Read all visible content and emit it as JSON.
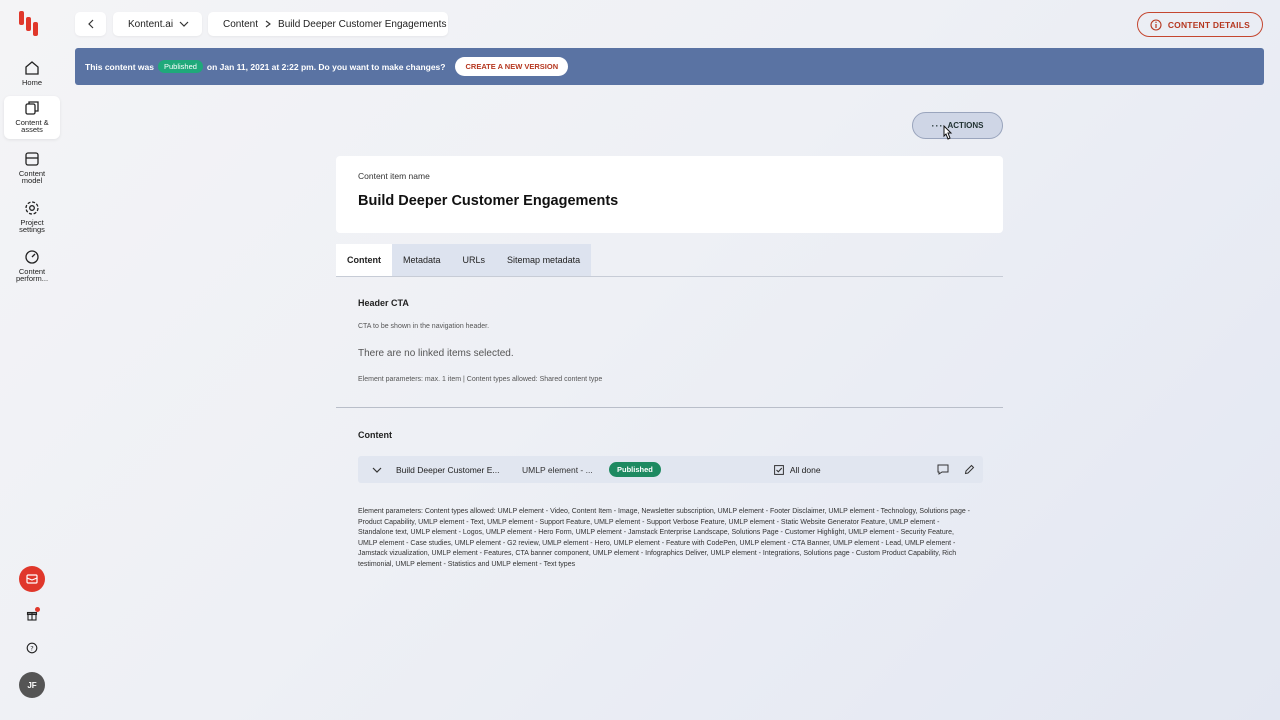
{
  "sidebar": {
    "items": [
      {
        "label": "Home"
      },
      {
        "label": "Content & assets"
      },
      {
        "label": "Content model"
      },
      {
        "label": "Project settings"
      },
      {
        "label": "Content perform..."
      }
    ],
    "avatar_initials": "JF"
  },
  "topbar": {
    "project": "Kontent.ai",
    "breadcrumb_root": "Content",
    "breadcrumb_current": "Build Deeper Customer Engagements",
    "details_label": "CONTENT DETAILS"
  },
  "banner": {
    "text_before": "This content was",
    "status": "Published",
    "text_after": "on Jan 11, 2021 at 2:22 pm. Do you want to make changes?",
    "button": "CREATE A NEW VERSION"
  },
  "actions_label": "ACTIONS",
  "item": {
    "name_label": "Content item name",
    "name": "Build Deeper Customer Engagements"
  },
  "tabs": [
    "Content",
    "Metadata",
    "URLs",
    "Sitemap metadata"
  ],
  "header_cta": {
    "title": "Header CTA",
    "hint": "CTA to be shown in the navigation header.",
    "empty": "There are no linked items selected.",
    "params": "Element parameters: max. 1 item | Content types allowed: Shared content type"
  },
  "content_section": {
    "title": "Content",
    "row": {
      "name": "Build Deeper Customer E...",
      "type": "UMLP element - ...",
      "status": "Published",
      "done": "All done"
    },
    "params": "Element parameters: Content types allowed: UMLP element - Video, Content Item - Image, Newsletter subscription, UMLP element - Footer Disclaimer, UMLP element - Technology, Solutions page - Product Capability, UMLP element - Text, UMLP element - Support Feature, UMLP element - Support Verbose Feature, UMLP element - Static Website Generator Feature, UMLP element - Standalone text, UMLP element - Logos, UMLP element - Hero Form, UMLP element - Jamstack Enterprise Landscape, Solutions Page - Customer Highlight, UMLP element - Security Feature, UMLP element - Case studies, UMLP element - G2 review, UMLP element - Hero, UMLP element - Feature with CodePen, UMLP element - CTA Banner, UMLP element - Lead, UMLP element - Jamstack vizualization, UMLP element - Features, CTA banner component, UMLP element - Infographics Deliver, UMLP element - Integrations, Solutions page - Custom Product Capability, Rich testimonial, UMLP element - Statistics and UMLP element - Text types"
  },
  "colors": {
    "brand": "#e0372b",
    "banner": "#5a73a3",
    "published": "#1fa97a"
  }
}
